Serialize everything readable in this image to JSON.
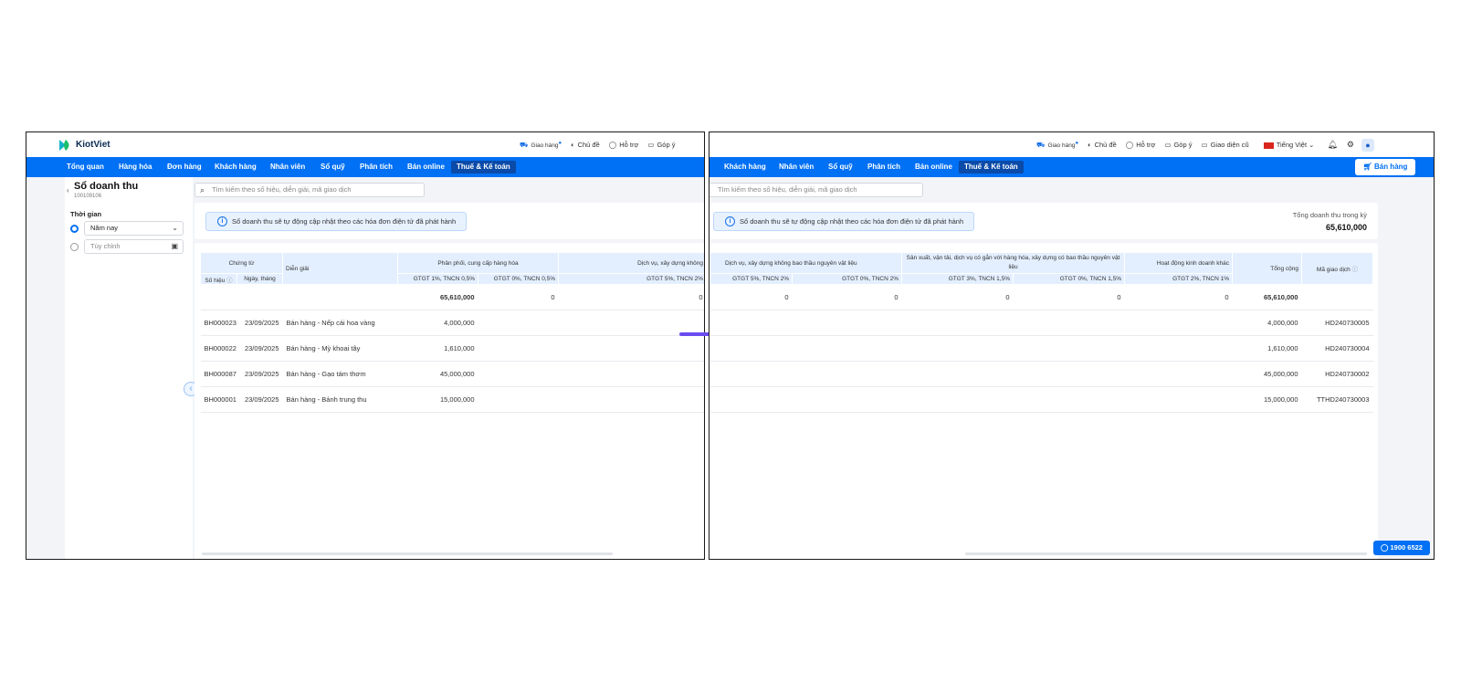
{
  "left": {
    "brand": "KiotViet",
    "top_actions": [
      "Giao hàng",
      "Chủ đề",
      "Hỗ trợ",
      "Góp ý"
    ],
    "nav": [
      "Tổng quan",
      "Hàng hóa",
      "Đơn hàng",
      "Khách hàng",
      "Nhân viên",
      "Sổ quỹ",
      "Phân tích",
      "Bán online",
      "Thuế & Kế toán"
    ],
    "page_title": "Sổ doanh thu",
    "page_code": "100109106",
    "search_placeholder": "Tìm kiếm theo số hiệu, diễn giải, mã giao dịch",
    "time_label": "Thời gian",
    "time_selected": "Năm nay",
    "time_custom": "Tùy chỉnh",
    "notice": "Sổ doanh thu sẽ tự động cập nhật theo các hóa đơn điện tử đã phát hành",
    "head": {
      "chung_tu": "Chứng từ",
      "dien_giai": "Diễn giải",
      "group1": "Phân phối, cung cấp hàng hóa",
      "group2": "Dịch vụ, xây dựng không",
      "so_hieu": "Số hiệu",
      "ngay_thang": "Ngày, tháng",
      "g1c1": "GTGT 1%, TNCN 0,5%",
      "g1c2": "GTGT 0%, TNCN 0,5%",
      "g2c1": "GTGT 5%, TNCN 2%"
    },
    "totals": [
      "65,610,000",
      "0",
      "0"
    ],
    "rows": [
      {
        "so_hieu": "BH000023",
        "ngay": "23/09/2025",
        "dien_giai": "Bán hàng - Nếp cái hoa vàng",
        "v1": "4,000,000"
      },
      {
        "so_hieu": "BH000022",
        "ngay": "23/09/2025",
        "dien_giai": "Bán hàng - Mỳ khoai tây",
        "v1": "1,610,000"
      },
      {
        "so_hieu": "BH000087",
        "ngay": "23/09/2025",
        "dien_giai": "Bán hàng - Gạo tám thơm",
        "v1": "45,000,000"
      },
      {
        "so_hieu": "BH000001",
        "ngay": "23/09/2025",
        "dien_giai": "Bán hàng - Bánh trung thu",
        "v1": "15,000,000"
      }
    ]
  },
  "right": {
    "top_actions": [
      "Giao hàng",
      "Chủ đề",
      "Hỗ trợ",
      "Góp ý",
      "Giao diện cũ"
    ],
    "language": "Tiếng Việt",
    "nav": [
      "Khách hàng",
      "Nhân viên",
      "Sổ quỹ",
      "Phân tích",
      "Bán online",
      "Thuế & Kế toán"
    ],
    "sell_button": "Bán hàng",
    "search_placeholder": "Tìm kiếm theo số hiệu, diễn giải, mã giao dịch",
    "notice": "Sổ doanh thu sẽ tự động cập nhật theo các hóa đơn điện tử đã phát hành",
    "total_label": "Tổng doanh thu trong kỳ",
    "total_value": "65,610,000",
    "head": {
      "group1": "Dịch vụ, xây dựng không bao thầu nguyên vật liệu",
      "group2": "Sản xuất, vận tải, dịch vụ có gắn với hàng hóa, xây dựng có bao thầu nguyên vật liệu",
      "group3": "Hoạt động kinh doanh khác",
      "tong_cong": "Tổng cộng",
      "ma_gd": "Mã giao dịch",
      "c1": "GTGT 5%, TNCN 2%",
      "c2": "GTGT 0%, TNCN 2%",
      "c3": "GTGT 3%, TNCN 1,5%",
      "c4": "GTGT 0%, TNCN 1,5%",
      "c5": "GTGT 2%, TNCN 1%"
    },
    "totals": [
      "0",
      "0",
      "0",
      "0",
      "0",
      "65,610,000"
    ],
    "rows": [
      {
        "tong": "4,000,000",
        "ma": "HD240730005"
      },
      {
        "tong": "1,610,000",
        "ma": "HD240730004"
      },
      {
        "tong": "45,000,000",
        "ma": "HD240730002"
      },
      {
        "tong": "15,000,000",
        "ma": "TTHD240730003"
      }
    ],
    "hotline": "1900 6522"
  },
  "colors": {
    "primary": "#0070f4",
    "nav_active": "#0a4aa8",
    "arrow": "#6a4cf0"
  }
}
